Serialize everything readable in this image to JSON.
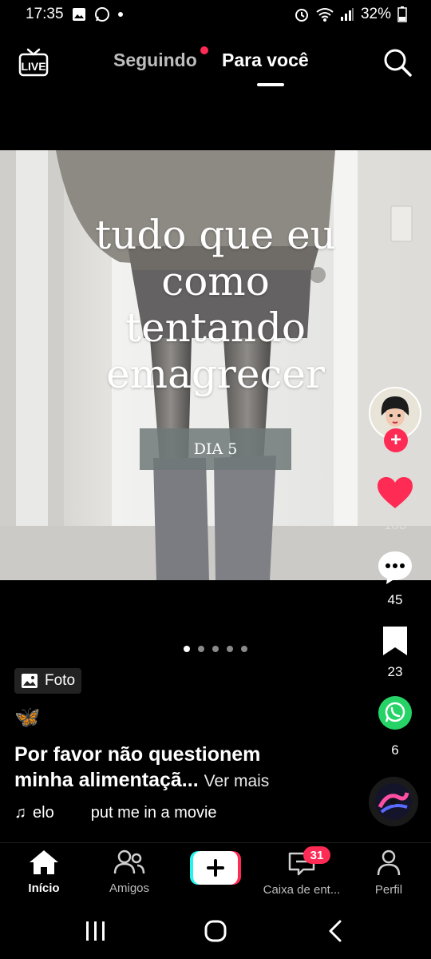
{
  "status_bar": {
    "time": "17:35",
    "battery": "32%",
    "left_icons": [
      "gallery-icon",
      "whatsapp-icon"
    ],
    "right_icons": [
      "alarm-icon",
      "wifi-icon",
      "signal-icon",
      "battery-icon"
    ]
  },
  "top_nav": {
    "live_label": "LIVE",
    "tabs": [
      {
        "label": "Seguindo",
        "has_dot": true
      },
      {
        "label": "Para você",
        "active": true
      }
    ]
  },
  "post": {
    "overlay_text": [
      "tudo que eu",
      "como",
      "tentando",
      "emagrecer"
    ],
    "day_label": "DIA 5",
    "pages_total": 5,
    "page_active": 1,
    "type_label": "Foto",
    "emoji": "🦋",
    "caption_line1": "Por favor não questionem",
    "caption_line2": "minha alimentaçã...",
    "see_more": "Ver mais",
    "music_left": "elo",
    "music_right": "put me in a movie"
  },
  "rail": {
    "likes": "183",
    "comments": "45",
    "saves": "23",
    "shares": "6",
    "accent": "#fe2c55",
    "share_color": "#25d366"
  },
  "bottom_nav": {
    "items": [
      {
        "label": "Início",
        "icon": "home-icon",
        "active": true
      },
      {
        "label": "Amigos",
        "icon": "friends-icon"
      },
      {
        "label": "",
        "icon": "plus-icon"
      },
      {
        "label": "Caixa de ent...",
        "icon": "inbox-icon",
        "badge": "31"
      },
      {
        "label": "Perfil",
        "icon": "profile-icon"
      }
    ]
  }
}
